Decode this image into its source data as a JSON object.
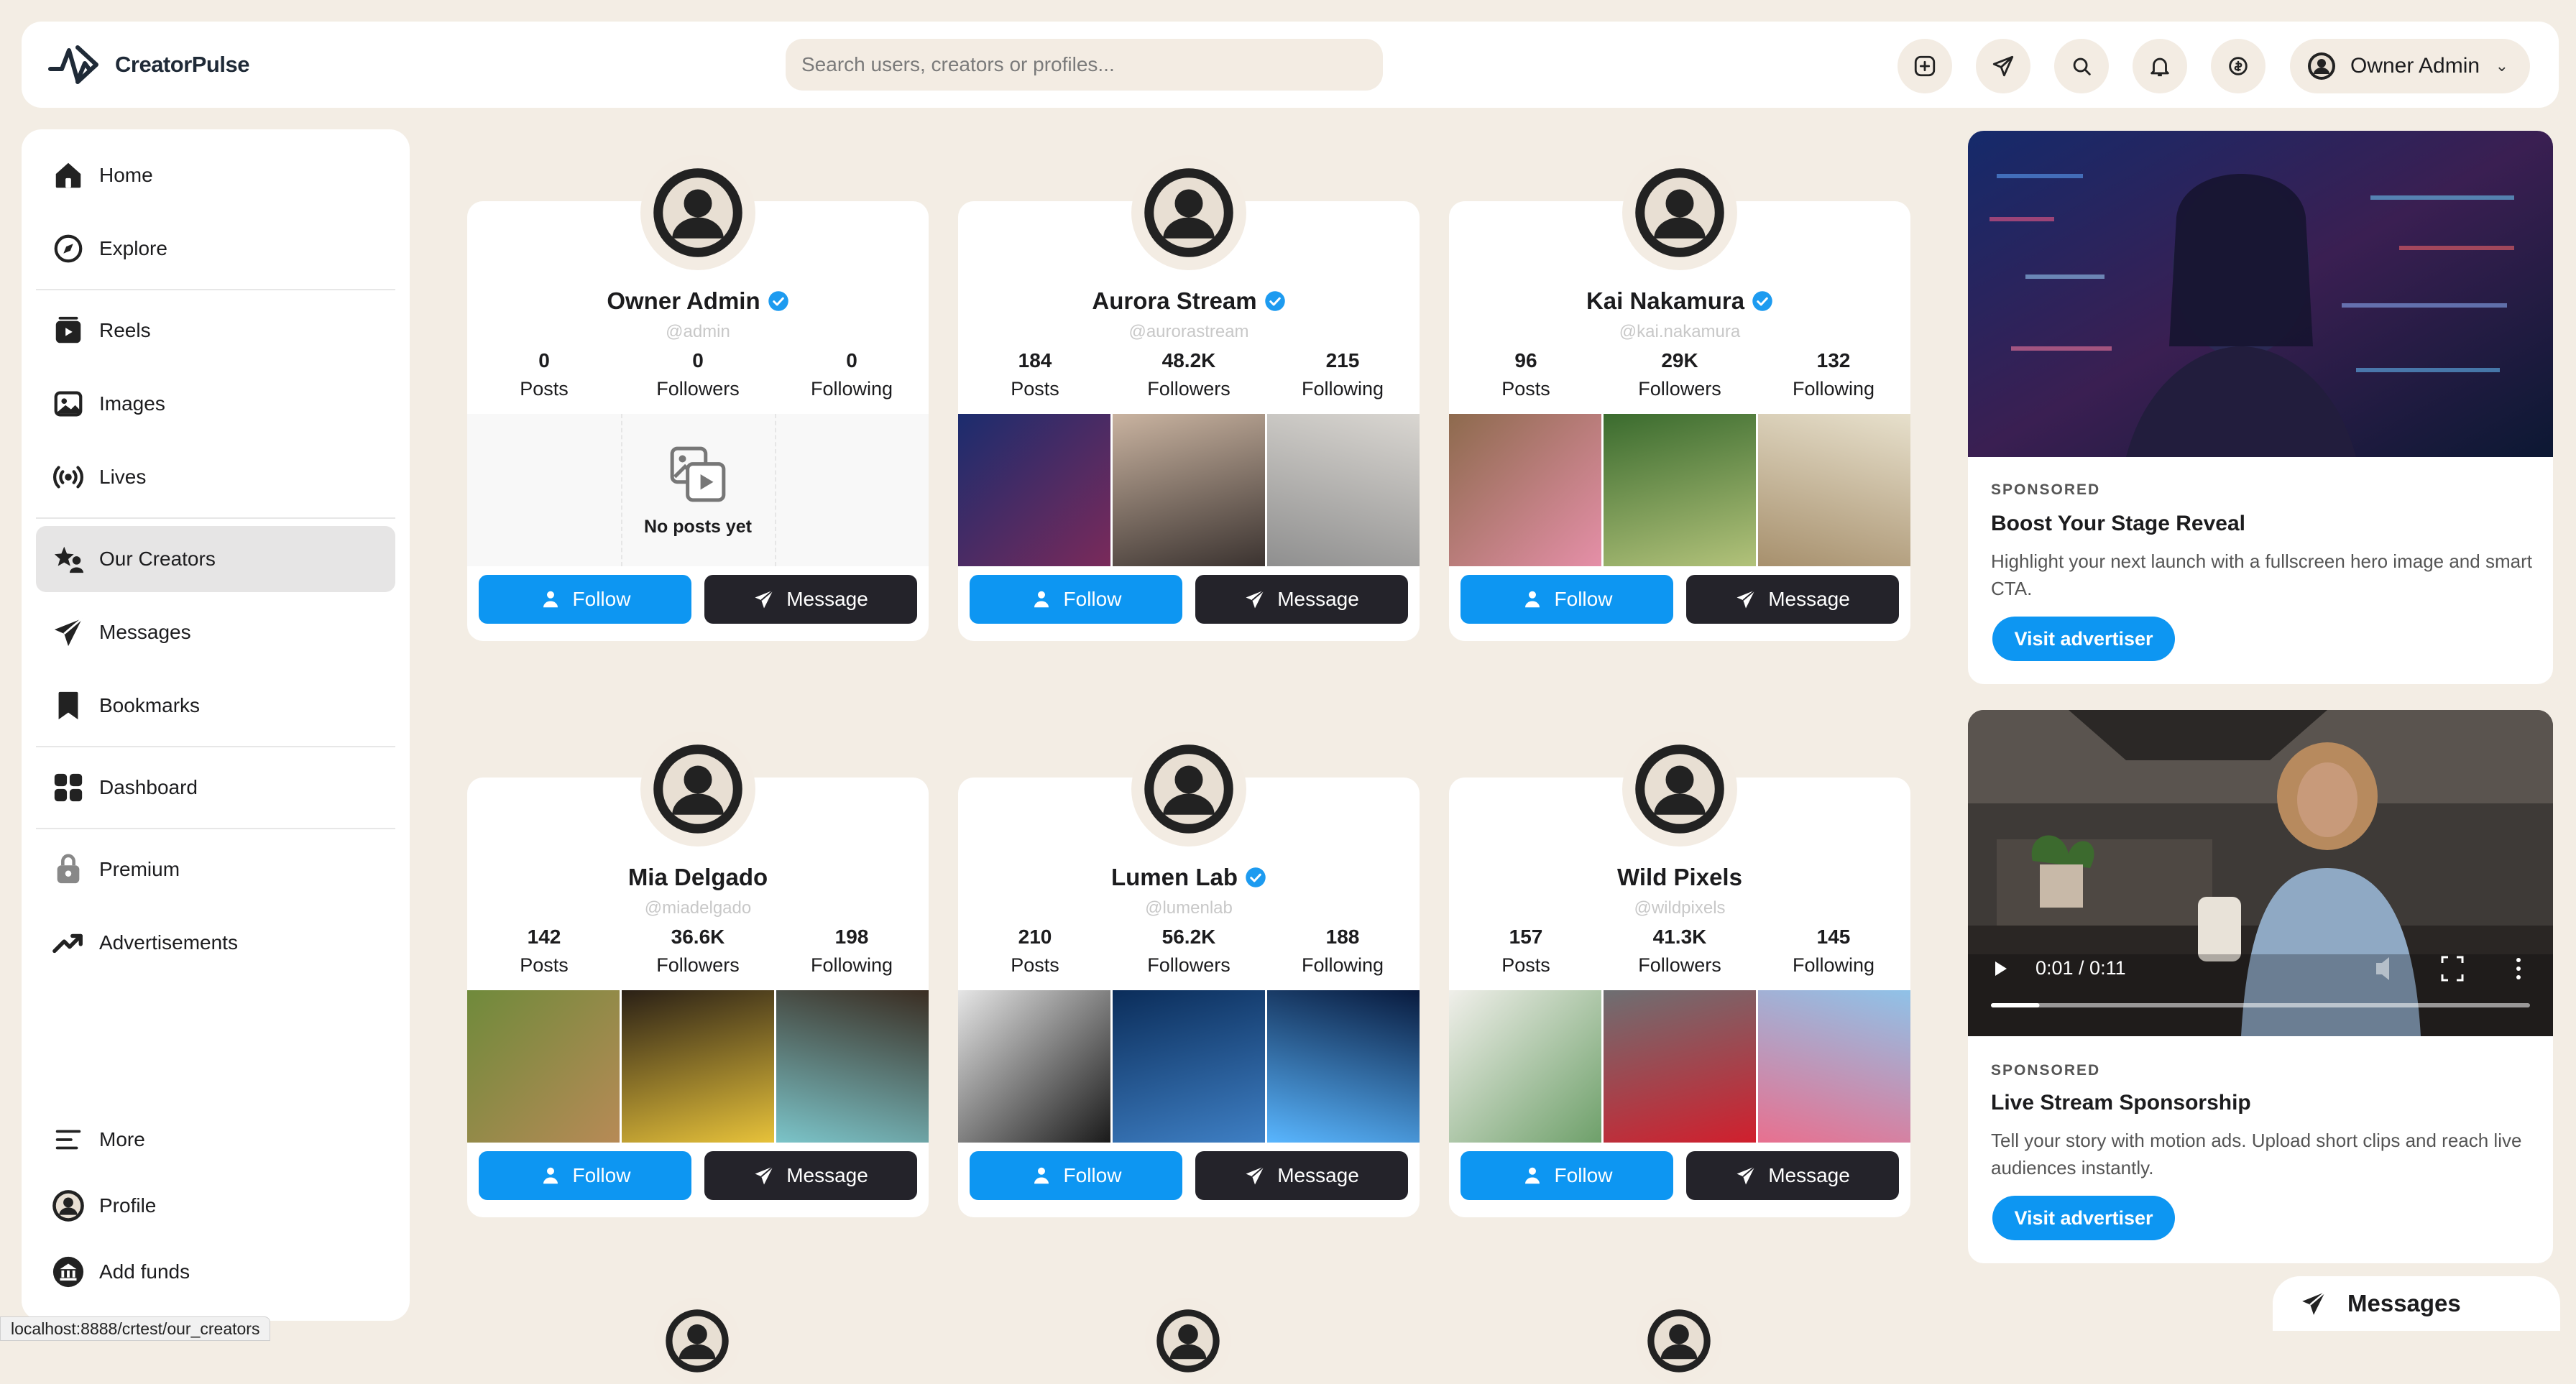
{
  "app": {
    "name": "CreatorPulse"
  },
  "search": {
    "placeholder": "Search users, creators or profiles..."
  },
  "topbar": {
    "icons": [
      "add-post-icon",
      "send-icon",
      "search-icon",
      "bell-icon",
      "wallet-icon"
    ],
    "user": {
      "name": "Owner Admin"
    }
  },
  "sidebar": {
    "items": [
      {
        "label": "Home",
        "icon": "home-icon"
      },
      {
        "label": "Explore",
        "icon": "compass-icon"
      },
      {
        "label": "Reels",
        "icon": "reels-icon"
      },
      {
        "label": "Images",
        "icon": "image-icon"
      },
      {
        "label": "Lives",
        "icon": "broadcast-icon"
      },
      {
        "label": "Our Creators",
        "icon": "star-users-icon",
        "active": true
      },
      {
        "label": "Messages",
        "icon": "send-icon"
      },
      {
        "label": "Bookmarks",
        "icon": "bookmark-icon"
      },
      {
        "label": "Dashboard",
        "icon": "grid-icon"
      },
      {
        "label": "Premium",
        "icon": "premium-icon"
      },
      {
        "label": "Advertisements",
        "icon": "trending-icon"
      }
    ],
    "bottom": [
      {
        "label": "More",
        "icon": "menu-icon"
      },
      {
        "label": "Profile",
        "icon": "profile-avatar"
      },
      {
        "label": "Add funds",
        "icon": "bank-icon"
      }
    ]
  },
  "labels": {
    "posts": "Posts",
    "followers": "Followers",
    "following": "Following",
    "follow": "Follow",
    "message": "Message",
    "no_posts": "No posts yet"
  },
  "creators": [
    {
      "name": "Owner Admin",
      "handle": "@admin",
      "verified": true,
      "posts": "0",
      "followers": "0",
      "following": "0",
      "has_posts": false
    },
    {
      "name": "Aurora Stream",
      "handle": "@aurorastream",
      "verified": true,
      "posts": "184",
      "followers": "48.2K",
      "following": "215",
      "has_posts": true
    },
    {
      "name": "Kai Nakamura",
      "handle": "@kai.nakamura",
      "verified": true,
      "posts": "96",
      "followers": "29K",
      "following": "132",
      "has_posts": true
    },
    {
      "name": "Mia Delgado",
      "handle": "@miadelgado",
      "verified": false,
      "posts": "142",
      "followers": "36.6K",
      "following": "198",
      "has_posts": true
    },
    {
      "name": "Lumen Lab",
      "handle": "@lumenlab",
      "verified": true,
      "posts": "210",
      "followers": "56.2K",
      "following": "188",
      "has_posts": true
    },
    {
      "name": "Wild Pixels",
      "handle": "@wildpixels",
      "verified": false,
      "posts": "157",
      "followers": "41.3K",
      "following": "145",
      "has_posts": true
    }
  ],
  "ads": [
    {
      "label": "SPONSORED",
      "title": "Boost Your Stage Reveal",
      "desc": "Highlight your next launch with a fullscreen hero image and smart CTA.",
      "cta": "Visit advertiser"
    },
    {
      "label": "SPONSORED",
      "title": "Live Stream Sponsorship",
      "desc": "Tell your story with motion ads. Upload short clips and reach live audiences instantly.",
      "cta": "Visit advertiser",
      "video_time": "0:01 / 0:11",
      "video_progress": 0.09
    }
  ],
  "floating": {
    "messages": "Messages"
  },
  "status_url": "localhost:8888/crtest/our_creators",
  "colors": {
    "accent": "#0d96f2",
    "dark_button": "#24232a",
    "page_bg": "#f3ede4"
  }
}
